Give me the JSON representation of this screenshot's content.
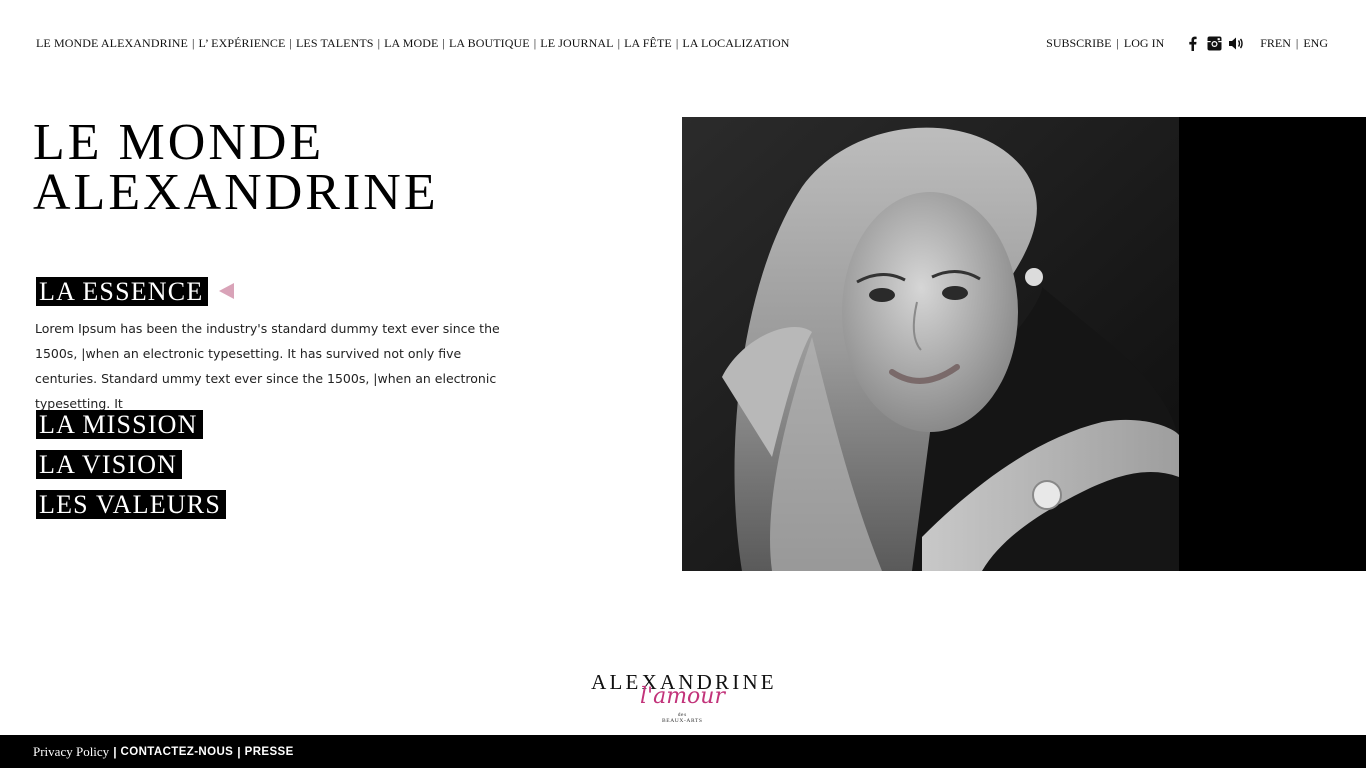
{
  "nav": {
    "items": [
      "LE MONDE ALEXANDRINE",
      "L’ EXPÉRIENCE",
      "LES TALENTS",
      "LA MODE",
      "LA BOUTIQUE",
      "LE JOURNAL",
      "LA FÊTE",
      "LA LOCALIZATION"
    ],
    "separator": "|"
  },
  "account": {
    "subscribe": "SUBSCRIBE",
    "login": "LOG IN",
    "separator": "|"
  },
  "social_icons": [
    "facebook-icon",
    "instagram-icon",
    "speaker-icon"
  ],
  "language": {
    "fr": "FREN",
    "en": "ENG",
    "separator": "|"
  },
  "hero": {
    "title_line1": "LE MONDE",
    "title_line2": "ALEXANDRINE"
  },
  "sections": {
    "essence": {
      "title": "LA ESSENCE",
      "text": "Lorem Ipsum has been the industry's standard dummy text ever since the 1500s, |when an electronic typesetting. It has survived not only five centuries. Standard ummy text ever since the 1500s, |when an electronic typesetting. It"
    },
    "mission": {
      "title": "LA MISSION"
    },
    "vision": {
      "title": "LA VISION"
    },
    "valeurs": {
      "title": "LES VALEURS"
    }
  },
  "brand": {
    "name": "ALEXANDRINE",
    "script": "l'amour",
    "small1": "des",
    "small2": "BEAUX-ARTS"
  },
  "footer": {
    "privacy": "Privacy Policy",
    "contact": "CONTACTEZ-NOUS",
    "press": "PRESSE",
    "separator": "|"
  },
  "colors": {
    "accent_pink": "#d9a3b8",
    "brand_magenta": "#c2337a",
    "black": "#000000"
  }
}
